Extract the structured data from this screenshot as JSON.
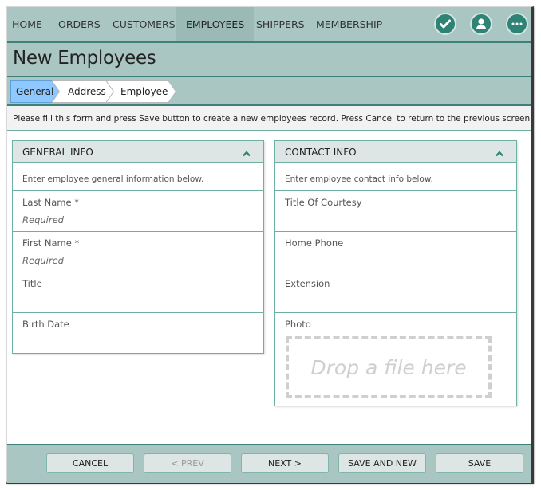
{
  "nav": {
    "items": [
      {
        "label": "HOME"
      },
      {
        "label": "ORDERS"
      },
      {
        "label": "CUSTOMERS"
      },
      {
        "label": "EMPLOYEES",
        "active": true
      },
      {
        "label": "SHIPPERS"
      },
      {
        "label": "MEMBERSHIP"
      }
    ],
    "icons": [
      "checkmark-icon",
      "user-icon",
      "more-icon"
    ]
  },
  "page": {
    "title": "New Employees",
    "hint": "Please fill this form and press Save button to create a new employees record. Press Cancel to return to the previous screen."
  },
  "breadcrumbs": [
    {
      "label": "General",
      "active": true
    },
    {
      "label": "Address"
    },
    {
      "label": "Employee"
    }
  ],
  "general_info": {
    "title": "GENERAL INFO",
    "description": "Enter employee general information below.",
    "fields": [
      {
        "label": "Last Name *",
        "placeholder": "Required"
      },
      {
        "label": "First Name *",
        "placeholder": "Required"
      },
      {
        "label": "Title",
        "placeholder": ""
      },
      {
        "label": "Birth Date",
        "placeholder": ""
      }
    ]
  },
  "contact_info": {
    "title": "CONTACT INFO",
    "description": "Enter employee contact info below.",
    "fields": [
      {
        "label": "Title Of Courtesy"
      },
      {
        "label": "Home Phone"
      },
      {
        "label": "Extension"
      }
    ],
    "photo": {
      "label": "Photo",
      "dropzone_text": "Drop a file here"
    }
  },
  "footer": {
    "cancel": "CANCEL",
    "prev": "< PREV",
    "next": "NEXT >",
    "save_and_new": "SAVE AND NEW",
    "save": "SAVE"
  },
  "colors": {
    "accent": "#2e8374",
    "bar_bg": "#a9c6c2",
    "active_crumb": "#8ec8ff",
    "panel_border": "#6fb0a4"
  }
}
